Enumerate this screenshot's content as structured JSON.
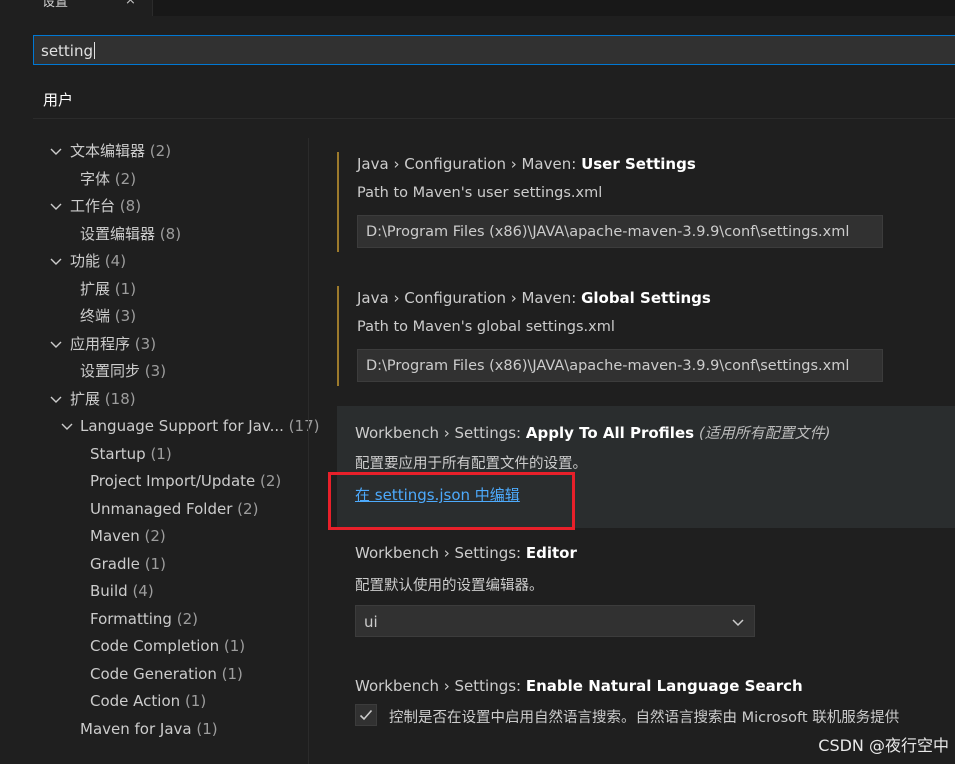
{
  "tab": {
    "label": "设置",
    "close": "×"
  },
  "search": {
    "value": "setting"
  },
  "scope": {
    "label": "用户"
  },
  "toc": [
    {
      "label": "文本编辑器",
      "count": "(2)",
      "chevron": true
    },
    {
      "label": "字体",
      "count": "(2)",
      "chevron": false
    },
    {
      "label": "工作台",
      "count": "(8)",
      "chevron": true
    },
    {
      "label": "设置编辑器",
      "count": "(8)",
      "chevron": false
    },
    {
      "label": "功能",
      "count": "(4)",
      "chevron": true
    },
    {
      "label": "扩展",
      "count": "(1)",
      "chevron": false
    },
    {
      "label": "终端",
      "count": "(3)",
      "chevron": false
    },
    {
      "label": "应用程序",
      "count": "(3)",
      "chevron": true
    },
    {
      "label": "设置同步",
      "count": "(3)",
      "chevron": false
    },
    {
      "label": "扩展",
      "count": "(18)",
      "chevron": true
    },
    {
      "label": "Language Support for Jav...",
      "count": "(17)",
      "chevron": true
    },
    {
      "label": "Startup",
      "count": "(1)",
      "chevron": false
    },
    {
      "label": "Project Import/Update",
      "count": "(2)",
      "chevron": false
    },
    {
      "label": "Unmanaged Folder",
      "count": "(2)",
      "chevron": false
    },
    {
      "label": "Maven",
      "count": "(2)",
      "chevron": false
    },
    {
      "label": "Gradle",
      "count": "(1)",
      "chevron": false
    },
    {
      "label": "Build",
      "count": "(4)",
      "chevron": false
    },
    {
      "label": "Formatting",
      "count": "(2)",
      "chevron": false
    },
    {
      "label": "Code Completion",
      "count": "(1)",
      "chevron": false
    },
    {
      "label": "Code Generation",
      "count": "(1)",
      "chevron": false
    },
    {
      "label": "Code Action",
      "count": "(1)",
      "chevron": false
    },
    {
      "label": "Maven for Java",
      "count": "(1)",
      "chevron": false
    }
  ],
  "settings": {
    "maven_user": {
      "prefix": "Java › Configuration › Maven: ",
      "name": "User Settings",
      "desc": "Path to Maven's user settings.xml",
      "value": "D:\\Program Files (x86)\\JAVA\\apache-maven-3.9.9\\conf\\settings.xml"
    },
    "maven_global": {
      "prefix": "Java › Configuration › Maven: ",
      "name": "Global Settings",
      "desc": "Path to Maven's global settings.xml",
      "value": "D:\\Program Files (x86)\\JAVA\\apache-maven-3.9.9\\conf\\settings.xml"
    },
    "apply_all": {
      "prefix": "Workbench › Settings: ",
      "name": "Apply To All Profiles",
      "extra": "(适用所有配置文件)",
      "desc": "配置要应用于所有配置文件的设置。",
      "link": "在 settings.json 中编辑"
    },
    "editor": {
      "prefix": "Workbench › Settings: ",
      "name": "Editor",
      "desc": "配置默认使用的设置编辑器。",
      "value": "ui"
    },
    "nls": {
      "prefix": "Workbench › Settings: ",
      "name": "Enable Natural Language Search",
      "desc": "控制是否在设置中启用自然语言搜索。自然语言搜索由 Microsoft 联机服务提供",
      "checked": true
    }
  },
  "watermark": "CSDN @夜行空中"
}
